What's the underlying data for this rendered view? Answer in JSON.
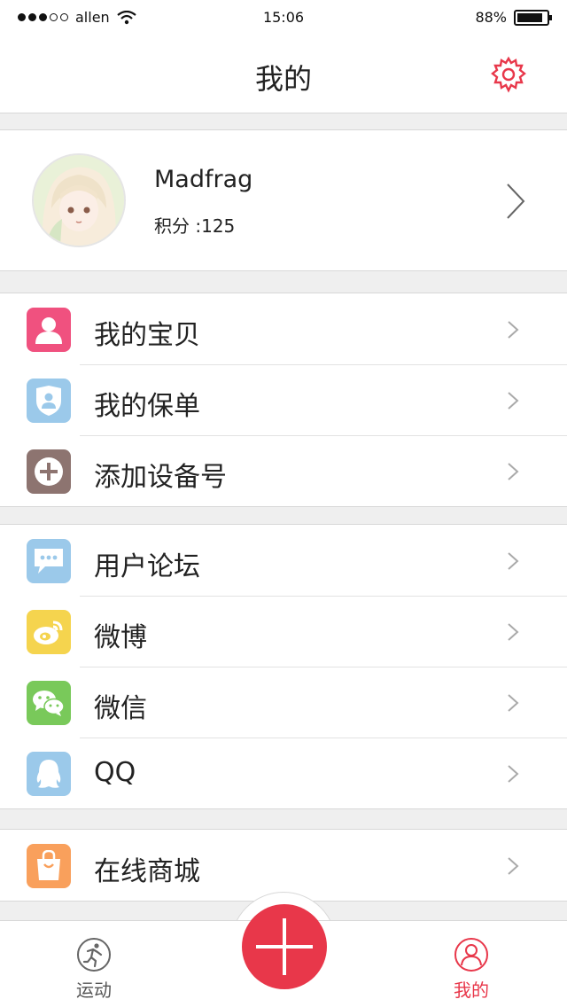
{
  "status": {
    "carrier": "allen",
    "time": "15:06",
    "battery": "88%",
    "battery_level": 0.88,
    "signal_bars": 3
  },
  "header": {
    "title": "我的",
    "settings_icon": "gear-icon"
  },
  "profile": {
    "name": "Madfrag",
    "score": "积分 :125"
  },
  "groups": [
    {
      "items": [
        {
          "label": "我的宝贝",
          "icon": "person-icon",
          "color": "#f0517f"
        },
        {
          "label": "我的保单",
          "icon": "shield-icon",
          "color": "#9bc9ea"
        },
        {
          "label": "添加设备号",
          "icon": "plus-circle-icon",
          "color": "#8d7470"
        }
      ]
    },
    {
      "items": [
        {
          "label": "用户论坛",
          "icon": "chat-bubble-icon",
          "color": "#9bc9ea"
        },
        {
          "label": "微博",
          "icon": "weibo-icon",
          "color": "#f5d44e"
        },
        {
          "label": "微信",
          "icon": "wechat-icon",
          "color": "#79c95a"
        },
        {
          "label": "QQ",
          "icon": "qq-penguin-icon",
          "color": "#9bc9ea"
        }
      ]
    },
    {
      "items": [
        {
          "label": "在线商城",
          "icon": "shopping-bag-icon",
          "color": "#f9a05c"
        }
      ]
    }
  ],
  "tabbar": {
    "tabs": [
      {
        "label": "运动",
        "icon": "running-icon",
        "active": false
      },
      {
        "label": "我的",
        "icon": "user-icon",
        "active": true
      }
    ],
    "center_button": "add-icon"
  },
  "colors": {
    "accent": "#e8374a",
    "background": "#efefef"
  }
}
